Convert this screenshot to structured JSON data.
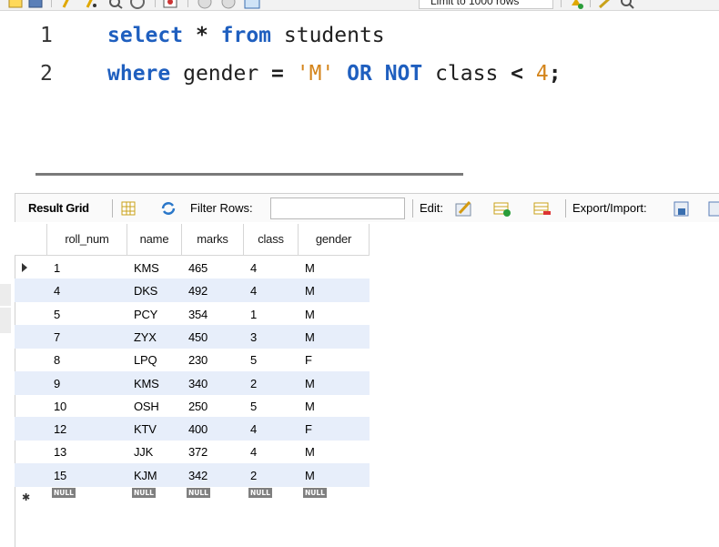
{
  "toolbar": {
    "limit_select_value": "Limit to 1000 rows"
  },
  "editor": {
    "lines": [
      {
        "number": "1"
      },
      {
        "number": "2"
      }
    ],
    "line1": {
      "select": "select",
      "star": " * ",
      "from": "from",
      "table": " students"
    },
    "line2": {
      "where": "where",
      "col1": " gender ",
      "eq": "=",
      "str": " 'M' ",
      "or": "OR",
      "not": " NOT",
      "col2": " class ",
      "lt": "<",
      "num": " 4",
      "semi": ";"
    }
  },
  "result_toolbar": {
    "result_grid_label": "Result Grid",
    "filter_rows_label": "Filter Rows:",
    "filter_value": "",
    "edit_label": "Edit:",
    "export_import_label": "Export/Import:"
  },
  "grid": {
    "columns": [
      "roll_num",
      "name",
      "marks",
      "class",
      "gender"
    ],
    "rows": [
      [
        "1",
        "KMS",
        "465",
        "4",
        "M"
      ],
      [
        "4",
        "DKS",
        "492",
        "4",
        "M"
      ],
      [
        "5",
        "PCY",
        "354",
        "1",
        "M"
      ],
      [
        "7",
        "ZYX",
        "450",
        "3",
        "M"
      ],
      [
        "8",
        "LPQ",
        "230",
        "5",
        "F"
      ],
      [
        "9",
        "KMS",
        "340",
        "2",
        "M"
      ],
      [
        "10",
        "OSH",
        "250",
        "5",
        "M"
      ],
      [
        "12",
        "KTV",
        "400",
        "4",
        "F"
      ],
      [
        "13",
        "JJK",
        "372",
        "4",
        "M"
      ],
      [
        "15",
        "KJM",
        "342",
        "2",
        "M"
      ]
    ],
    "null_label": "NULL"
  },
  "colors": {
    "keyword": "#1f5fbf",
    "literal": "#d4841a",
    "row_alt": "#e7eefa"
  }
}
